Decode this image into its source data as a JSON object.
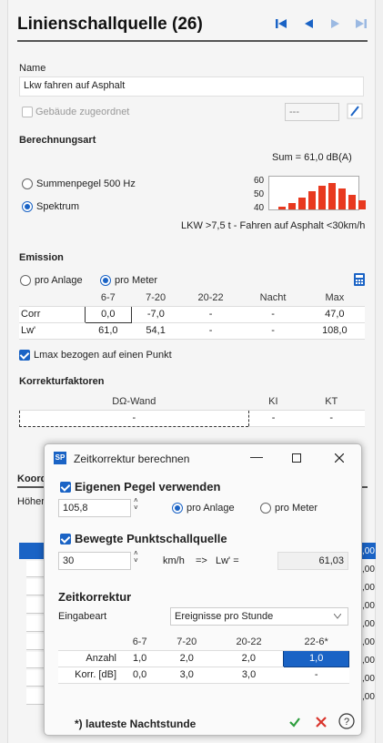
{
  "title": "Linienschallquelle (26)",
  "name_label": "Name",
  "name_value": "Lkw fahren auf Asphalt",
  "building_label": "Gebäude zugeordnet",
  "building_value": "---",
  "calc_type_label": "Berechnungsart",
  "sum_text": "Sum = 61,0 dB(A)",
  "radio_sum": "Summenpegel 500 Hz",
  "radio_spectrum": "Spektrum",
  "spectrum_chart": {
    "y_ticks": [
      "60",
      "50",
      "40"
    ],
    "bars": [
      42,
      44,
      48,
      52,
      56,
      58,
      54,
      50,
      46
    ],
    "ymin": 40,
    "ymax": 62
  },
  "spectrum_desc": "LKW >7,5 t - Fahren auf Asphalt <30km/h",
  "emission_label": "Emission",
  "radio_pro_anlage": "pro Anlage",
  "radio_pro_meter": "pro Meter",
  "emission_table": {
    "headers": [
      "",
      "6-7",
      "7-20",
      "20-22",
      "Nacht",
      "Max"
    ],
    "rows": [
      [
        "Corr",
        "0,0",
        "-7,0",
        "-",
        "-",
        "47,0"
      ],
      [
        "Lw'",
        "61,0",
        "54,1",
        "-",
        "-",
        "108,0"
      ]
    ]
  },
  "lmax_label": "Lmax bezogen auf einen Punkt",
  "korr_label": "Korrekturfaktoren",
  "korr_table": {
    "headers": [
      "DΩ-Wand",
      "KI",
      "KT"
    ],
    "values": [
      "-",
      "-",
      "-"
    ]
  },
  "bg_label_koor": "Koord",
  "bg_label_hoehe": "Höher",
  "bg_values": [
    ",00",
    ",00",
    ",00",
    ",00",
    ",00",
    ",00",
    ",00",
    ",00",
    ",00",
    ",00"
  ],
  "dialog": {
    "title": "Zeitkorrektur berechnen",
    "eigenen_label": "Eigenen Pegel verwenden",
    "pegel_value": "105,8",
    "pro_anlage": "pro Anlage",
    "pro_meter": "pro Meter",
    "bewegte_label": "Bewegte Punktschallquelle",
    "speed_value": "30",
    "speed_unit": "km/h",
    "arrow": "=>",
    "lw_label": "Lw' =",
    "lw_value": "61,03",
    "zeit_label": "Zeitkorrektur",
    "eingabe_label": "Eingabeart",
    "eingabe_value": "Ereignisse pro Stunde",
    "table": {
      "headers": [
        "",
        "6-7",
        "7-20",
        "20-22",
        "22-6*"
      ],
      "rows": [
        [
          "Anzahl",
          "1,0",
          "2,0",
          "2,0",
          "1,0"
        ],
        [
          "Korr. [dB]",
          "0,0",
          "3,0",
          "3,0",
          "-"
        ]
      ]
    },
    "footnote": "*) lauteste Nachtstunde"
  },
  "colors": {
    "accent": "#1a63c5",
    "bar": "#e8391f",
    "ok": "#2e9e3e",
    "cancel": "#d9342b"
  }
}
